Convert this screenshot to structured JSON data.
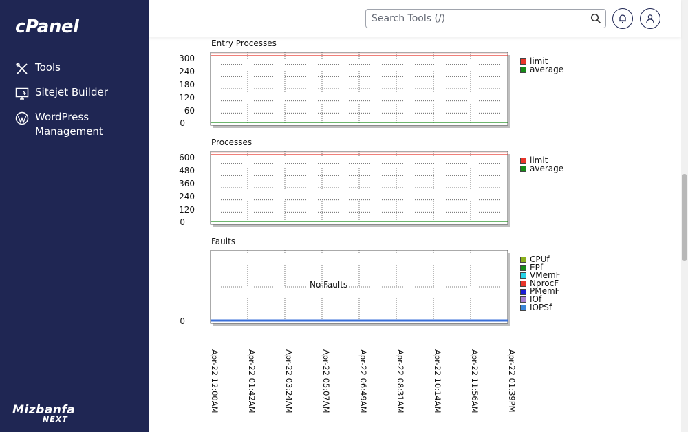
{
  "app": {
    "logo_text": "cPanel"
  },
  "sidebar": {
    "items": [
      {
        "label": "Tools",
        "icon": "tools-icon"
      },
      {
        "label": "Sitejet Builder",
        "icon": "sitejet-icon"
      },
      {
        "label": "WordPress\nManagement",
        "icon": "wordpress-icon"
      }
    ],
    "brand": {
      "top": "Mizbanfa",
      "bottom": "NEXT"
    }
  },
  "header": {
    "search": {
      "placeholder": "Search Tools (/)",
      "value": ""
    },
    "icons": [
      "bell-icon",
      "user-icon"
    ]
  },
  "colors": {
    "sidebar_bg": "#1f2653",
    "limit": "#e8352a",
    "average": "#178a18",
    "iopsf_line": "#3a6fd8"
  },
  "x_labels": [
    "Apr-22 12:00AM",
    "Apr-22 01:42AM",
    "Apr-22 03:24AM",
    "Apr-22 05:07AM",
    "Apr-22 06:49AM",
    "Apr-22 08:31AM",
    "Apr-22 10:14AM",
    "Apr-22 11:56AM",
    "Apr-22 01:39PM"
  ],
  "chart_data": [
    {
      "type": "line",
      "title": "Entry Processes",
      "x": [
        "Apr-22 12:00AM",
        "Apr-22 01:42AM",
        "Apr-22 03:24AM",
        "Apr-22 05:07AM",
        "Apr-22 06:49AM",
        "Apr-22 08:31AM",
        "Apr-22 10:14AM",
        "Apr-22 11:56AM",
        "Apr-22 01:39PM"
      ],
      "yticks": [
        "300",
        "240",
        "180",
        "120",
        "60",
        "0"
      ],
      "ylim": [
        0,
        300
      ],
      "grid": true,
      "legend_position": "right",
      "series": [
        {
          "name": "limit",
          "color": "#e8352a",
          "values": [
            300,
            300,
            300,
            300,
            300,
            300,
            300,
            300,
            300
          ]
        },
        {
          "name": "average",
          "color": "#178a18",
          "values": [
            0,
            0,
            0,
            0,
            0,
            0,
            0,
            0,
            0
          ]
        }
      ]
    },
    {
      "type": "line",
      "title": "Processes",
      "x": [
        "Apr-22 12:00AM",
        "Apr-22 01:42AM",
        "Apr-22 03:24AM",
        "Apr-22 05:07AM",
        "Apr-22 06:49AM",
        "Apr-22 08:31AM",
        "Apr-22 10:14AM",
        "Apr-22 11:56AM",
        "Apr-22 01:39PM"
      ],
      "yticks": [
        "600",
        "480",
        "360",
        "240",
        "120",
        "0"
      ],
      "ylim": [
        0,
        600
      ],
      "grid": true,
      "legend_position": "right",
      "series": [
        {
          "name": "limit",
          "color": "#e8352a",
          "values": [
            600,
            600,
            600,
            600,
            600,
            600,
            600,
            600,
            600
          ]
        },
        {
          "name": "average",
          "color": "#178a18",
          "values": [
            0,
            0,
            0,
            0,
            0,
            0,
            0,
            0,
            0
          ]
        }
      ]
    },
    {
      "type": "line",
      "title": "Faults",
      "x": [
        "Apr-22 12:00AM",
        "Apr-22 01:42AM",
        "Apr-22 03:24AM",
        "Apr-22 05:07AM",
        "Apr-22 06:49AM",
        "Apr-22 08:31AM",
        "Apr-22 10:14AM",
        "Apr-22 11:56AM",
        "Apr-22 01:39PM"
      ],
      "yticks": [
        "0"
      ],
      "ylim": [
        0,
        1
      ],
      "grid": true,
      "legend_position": "right",
      "annotation": "No Faults",
      "series": [
        {
          "name": "CPUf",
          "color": "#8ab01c",
          "values": [
            0,
            0,
            0,
            0,
            0,
            0,
            0,
            0,
            0
          ]
        },
        {
          "name": "EPf",
          "color": "#178a18",
          "values": [
            0,
            0,
            0,
            0,
            0,
            0,
            0,
            0,
            0
          ]
        },
        {
          "name": "VMemF",
          "color": "#27d2e8",
          "values": [
            0,
            0,
            0,
            0,
            0,
            0,
            0,
            0,
            0
          ]
        },
        {
          "name": "NprocF",
          "color": "#e8352a",
          "values": [
            0,
            0,
            0,
            0,
            0,
            0,
            0,
            0,
            0
          ]
        },
        {
          "name": "PMemF",
          "color": "#1b1bd6",
          "values": [
            0,
            0,
            0,
            0,
            0,
            0,
            0,
            0,
            0
          ]
        },
        {
          "name": "IOf",
          "color": "#a57ed0",
          "values": [
            0,
            0,
            0,
            0,
            0,
            0,
            0,
            0,
            0
          ]
        },
        {
          "name": "IOPSf",
          "color": "#3a85d8",
          "values": [
            0,
            0,
            0,
            0,
            0,
            0,
            0,
            0,
            0
          ]
        }
      ]
    }
  ]
}
